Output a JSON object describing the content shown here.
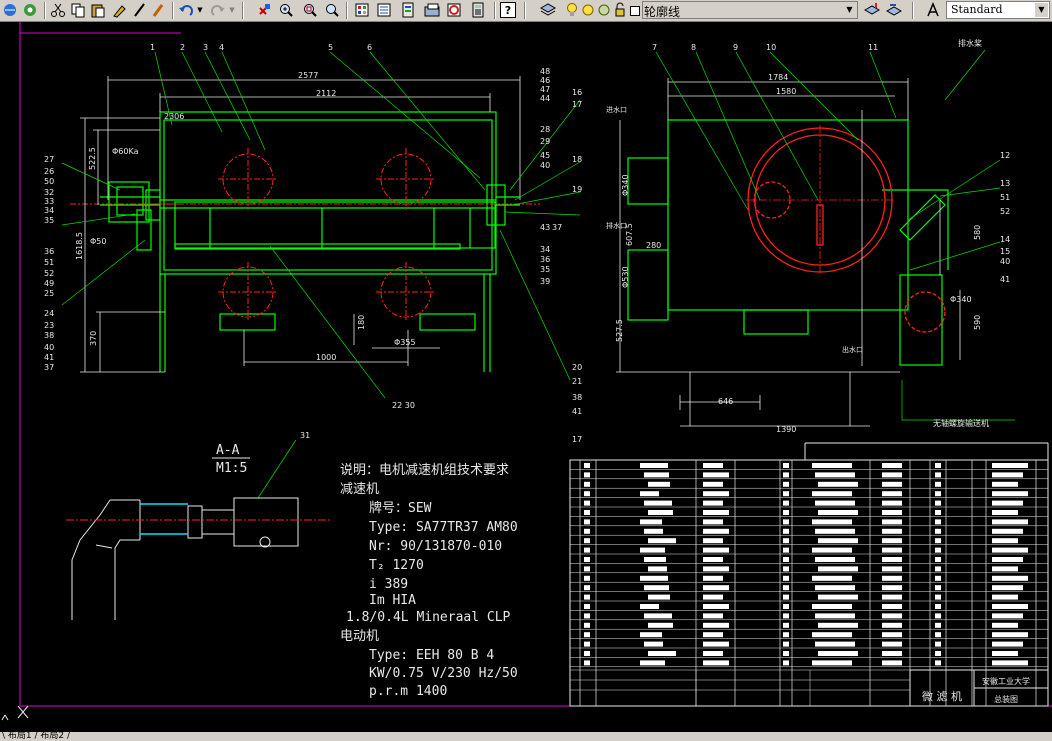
{
  "toolbar": {
    "linetype_text": "轮廓线",
    "textstyle_value": "Standard",
    "buttons": [
      "undo-icon",
      "redo-icon",
      "pan-icon",
      "zoom-realtime-icon",
      "zoom-window-icon",
      "zoom-previous-icon",
      "properties-icon",
      "design-center-icon",
      "tool-palettes-icon",
      "markup-icon",
      "calculator-icon",
      "help-icon",
      "layer-manager-icon",
      "layer-previous-icon",
      "text-style-icon"
    ]
  },
  "statusbar": {
    "layout_tabs": "\\ 布局1 / 布局2 /"
  },
  "drawing": {
    "dims_front": {
      "overall": "2577",
      "inner": "2112",
      "left_small": "2306",
      "d60": "Φ60Ka",
      "h522": "522.5",
      "h1618": "1618.5",
      "d50": "Φ50",
      "h1000": "1000",
      "d355": "Φ355",
      "h370": "370",
      "h180": "180"
    },
    "dims_side": {
      "w1784": "1784",
      "w1580": "1580",
      "inlet": "进水口",
      "outlet": "出水口",
      "drain": "排水口",
      "d280": "280",
      "h607": "607.5",
      "h527": "527.5",
      "w646": "646",
      "w1390": "1390",
      "h580": "580",
      "h590": "590",
      "d340": "Φ340",
      "d530": "Φ530",
      "conveyor": "无轴螺旋输送机",
      "spray": "排水桨"
    },
    "callouts_top": [
      "1",
      "2",
      "3",
      "4",
      "5",
      "6",
      "7",
      "8",
      "9",
      "10",
      "11"
    ],
    "callouts_left": [
      "27",
      "26",
      "50",
      "32",
      "33",
      "34",
      "35",
      "36",
      "51",
      "52",
      "49",
      "25",
      "24",
      "23",
      "38",
      "40",
      "41",
      "37"
    ],
    "callouts_mid_right": [
      "48",
      "46",
      "47",
      "44",
      "16",
      "17",
      "28",
      "29",
      "45",
      "40",
      "18",
      "19",
      "43",
      "37",
      "34",
      "36",
      "35",
      "39",
      "20",
      "21",
      "38",
      "41",
      "17"
    ],
    "callouts_far_right": [
      "12",
      "13",
      "51",
      "52",
      "14",
      "15",
      "40",
      "41"
    ],
    "callout_bottom": "22 30",
    "section": {
      "title": "A-A",
      "scale": "M1:5",
      "callout": "31"
    },
    "notes": {
      "title": "说明：电机减速机组技术要求",
      "reducer": "减速机",
      "brand": "牌号：SEW",
      "type": "Type: SA77TR37 AM80",
      "nr": "Nr:   90/131870-010",
      "t2": "T₂    1270",
      "i": "i     389",
      "im": "Im    HIA",
      "oil": "1.8/0.4L Mineraal CLP",
      "motor": "电动机",
      "mtype": "Type: EEH 80 B 4",
      "kw": "KW/0.75  V/230 Hz/50",
      "rpm": "p.r.m 1400"
    },
    "title_block": {
      "name": "微 滤 机",
      "university": "安徽工业大学",
      "drawing_type": "总装图"
    }
  }
}
